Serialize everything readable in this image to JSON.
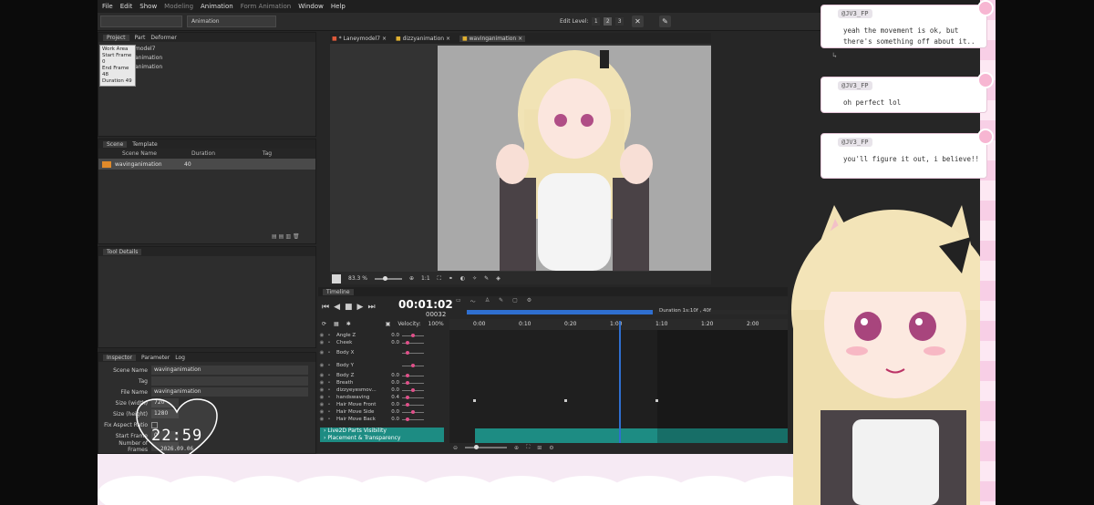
{
  "menu": [
    "File",
    "Edit",
    "Show",
    "Modeling",
    "Animation",
    "Form Animation",
    "Window",
    "Help"
  ],
  "toolbar": {
    "mode_combo": "Animation",
    "edit_level_label": "Edit Level:",
    "levels": [
      "1",
      "2",
      "3"
    ]
  },
  "project_panel": {
    "tabs": [
      "Project",
      "Part",
      "Deformer"
    ],
    "popup": [
      "Work Area",
      "Start Frame 0",
      "End Frame 48",
      "Duration 49"
    ],
    "tree_items": [
      "model7",
      "animation",
      "animation"
    ]
  },
  "scene_panel": {
    "tabs": [
      "Scene",
      "Template"
    ],
    "columns": [
      "Scene Name",
      "Duration",
      "Tag"
    ],
    "rows": [
      {
        "name": "wavinganimation",
        "duration": "40",
        "tag": ""
      }
    ]
  },
  "tool_details": {
    "title": "Tool Details"
  },
  "inspector": {
    "tabs": [
      "Inspector",
      "Parameter",
      "Log"
    ],
    "rows": [
      {
        "label": "Scene Name",
        "value": "wavinganimation"
      },
      {
        "label": "Tag",
        "value": ""
      },
      {
        "label": "File Name",
        "value": "wavinganimation"
      },
      {
        "label": "Size (width)",
        "value": "720"
      },
      {
        "label": "Size (height)",
        "value": "1280"
      },
      {
        "label": "Fix Aspect Ratio",
        "value": ""
      },
      {
        "label": "Start Frame",
        "value": "0"
      },
      {
        "label": "Number of Frames",
        "value": ""
      }
    ]
  },
  "clock": {
    "time": "22:59",
    "date": "2026.09.06"
  },
  "doc_tabs": [
    "Laneymodel7",
    "dizzyanimation",
    "wavinganimation"
  ],
  "viewport": {
    "zoom": "83.3 %",
    "ratio": "1:1"
  },
  "timeline": {
    "title": "Timeline",
    "timecode": "00:01:02",
    "frame": "00032",
    "velocity_label": "Velocity:",
    "velocity": "100%",
    "duration_label": "Duration 1s:10f , 40f",
    "ruler": [
      "0:00",
      "0:10",
      "0:20",
      "1:00",
      "1:10",
      "1:20",
      "2:00"
    ],
    "playhead_fraction": 0.48,
    "params": [
      {
        "name": "Angle Z",
        "value": "0.0"
      },
      {
        "name": "Cheek",
        "value": "0.0"
      },
      {
        "name": "Body X",
        "value": ""
      },
      {
        "name": "Body Y",
        "value": ""
      },
      {
        "name": "Body Z",
        "value": "0.0"
      },
      {
        "name": "Breath",
        "value": "0.0"
      },
      {
        "name": "dizzyeyesmov...",
        "value": "0.0"
      },
      {
        "name": "handswaving",
        "value": "0.4"
      },
      {
        "name": "Hair Move Front",
        "value": "0.0"
      },
      {
        "name": "Hair Move Side",
        "value": "0.0"
      },
      {
        "name": "Hair Move Back",
        "value": "0.0"
      }
    ],
    "groups": [
      "Live2D Parts Visibility",
      "Placement & Transparency"
    ]
  },
  "chat": [
    {
      "user": "@JV3_FP",
      "lines": [
        "yeah the movement is ok, but",
        "there's something off about it.."
      ]
    },
    {
      "user": "@JV3_FP",
      "lines": [
        "oh perfect lol"
      ]
    },
    {
      "user": "@JV3_FP",
      "lines": [
        "you'll figure it out, i believe!!"
      ]
    }
  ],
  "colors": {
    "accent": "#e0508a",
    "timeline_blue": "#2f6fd0",
    "teal": "#1d8c83",
    "pink": "#f7b6d2"
  }
}
